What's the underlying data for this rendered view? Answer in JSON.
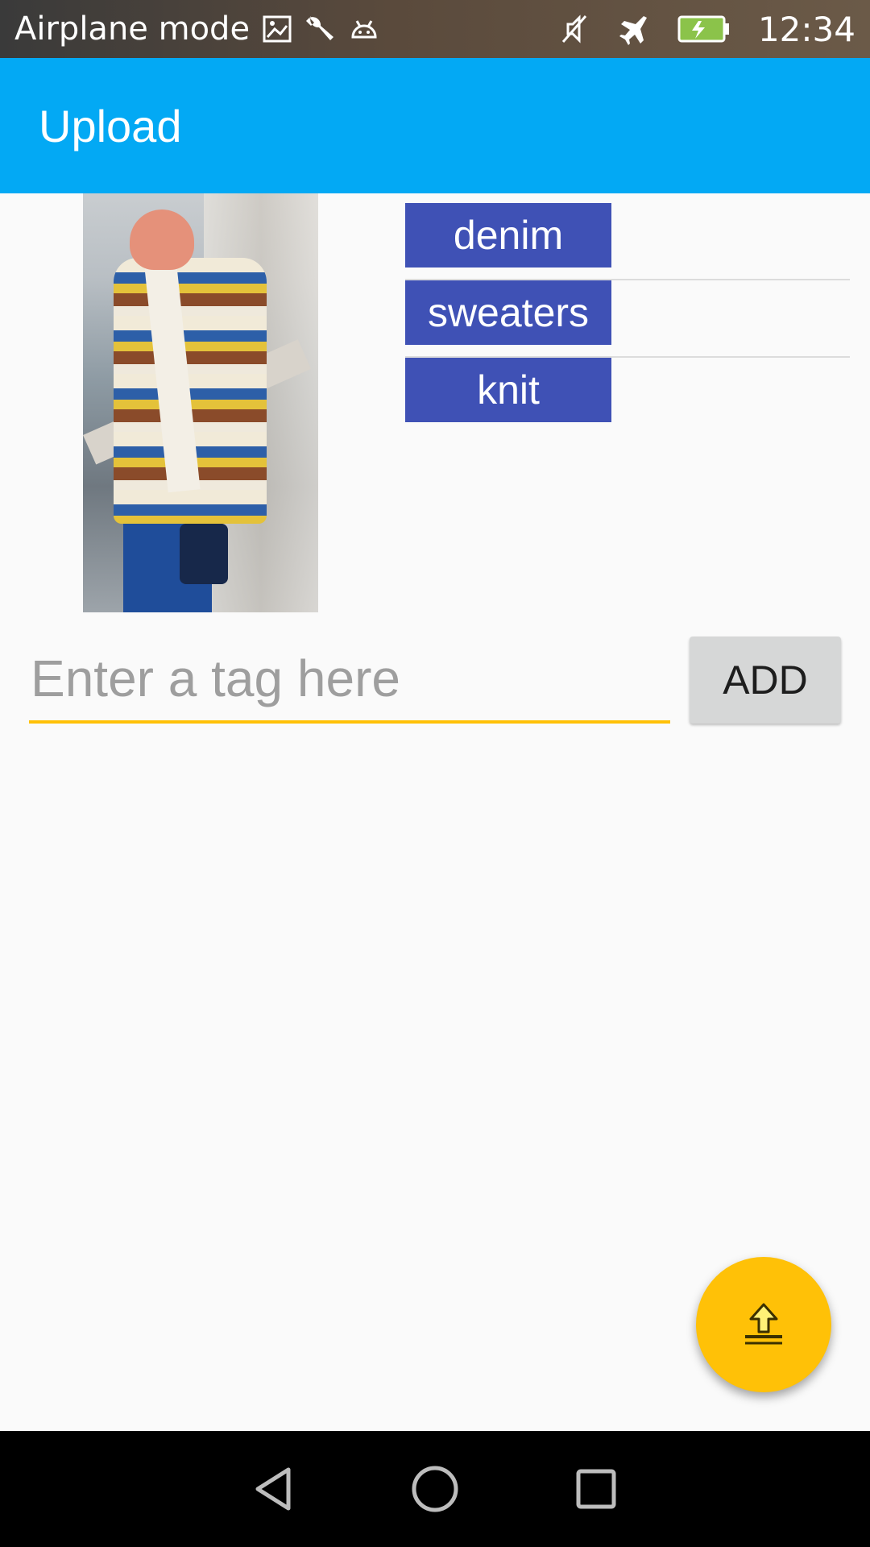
{
  "status_bar": {
    "mode_text": "Airplane mode",
    "time": "12:34",
    "left_icons": [
      "image-icon",
      "wrench-icon",
      "android-icon"
    ],
    "right_icons": [
      "mute-icon",
      "airplane-icon",
      "battery-charging-icon"
    ]
  },
  "app_bar": {
    "title": "Upload"
  },
  "tags": [
    {
      "label": "denim"
    },
    {
      "label": "sweaters"
    },
    {
      "label": "knit"
    }
  ],
  "tag_input": {
    "placeholder": "Enter a tag here",
    "value": ""
  },
  "add_button": {
    "label": "ADD"
  },
  "fab": {
    "icon": "upload-icon",
    "color": "#ffc107"
  },
  "nav_bar": {
    "icons": [
      "back-icon",
      "home-icon",
      "recents-icon"
    ]
  },
  "colors": {
    "app_bar": "#03a9f4",
    "tag_chip": "#3f51b5",
    "accent": "#ffc107"
  }
}
